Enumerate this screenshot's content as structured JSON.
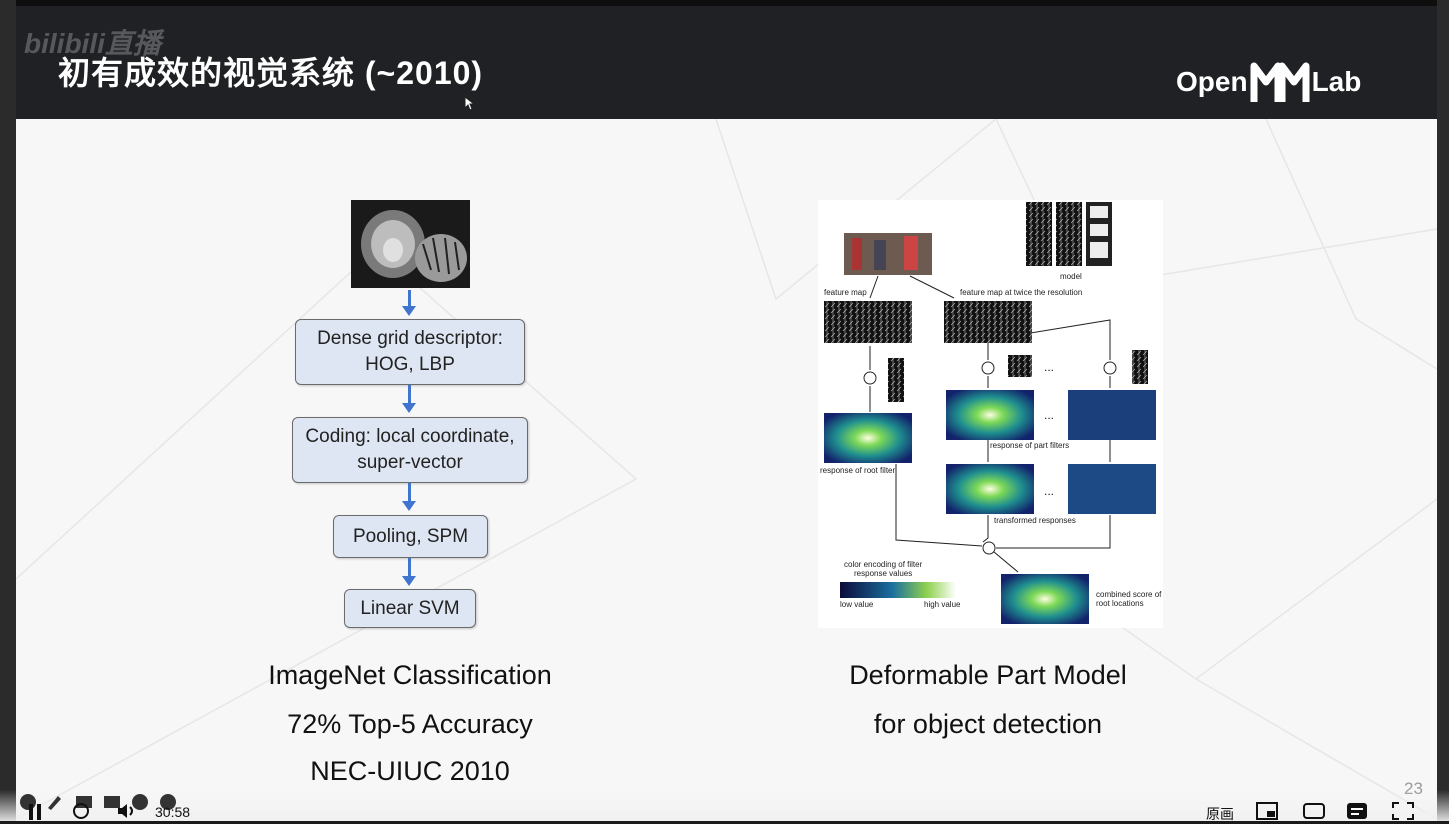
{
  "header": {
    "watermark": "bilibili直播",
    "title": "初有成效的视觉系统 (~2010)",
    "logo_left": "Open",
    "logo_right": "Lab"
  },
  "left_figure": {
    "steps": [
      "Dense grid descriptor:\nHOG, LBP",
      "Coding:  local coordinate,\nsuper-vector",
      "Pooling, SPM",
      "Linear SVM"
    ],
    "captions": [
      "ImageNet Classification",
      "72% Top-5 Accuracy",
      "NEC-UIUC 2010"
    ]
  },
  "right_figure": {
    "labels": {
      "model": "model",
      "feature_map": "feature map",
      "feature_map_twice": "feature map at twice the resolution",
      "response_part": "response of part filters",
      "response_root": "response of root filter",
      "transformed": "transformed responses",
      "color_encoding": "color encoding of filter\nresponse values",
      "low": "low value",
      "high": "high value",
      "combined": "combined score of\nroot locations",
      "ellipsis": "..."
    },
    "captions": [
      "Deformable Part Model",
      "for object detection"
    ]
  },
  "slide_number": "23",
  "player": {
    "time": "30:58",
    "quality": "原画"
  },
  "colors": {
    "header_bg": "#1f2125",
    "slide_bg": "#f7f7f7",
    "box_fill": "#dfe6f3",
    "arrow": "#3f74cf"
  }
}
